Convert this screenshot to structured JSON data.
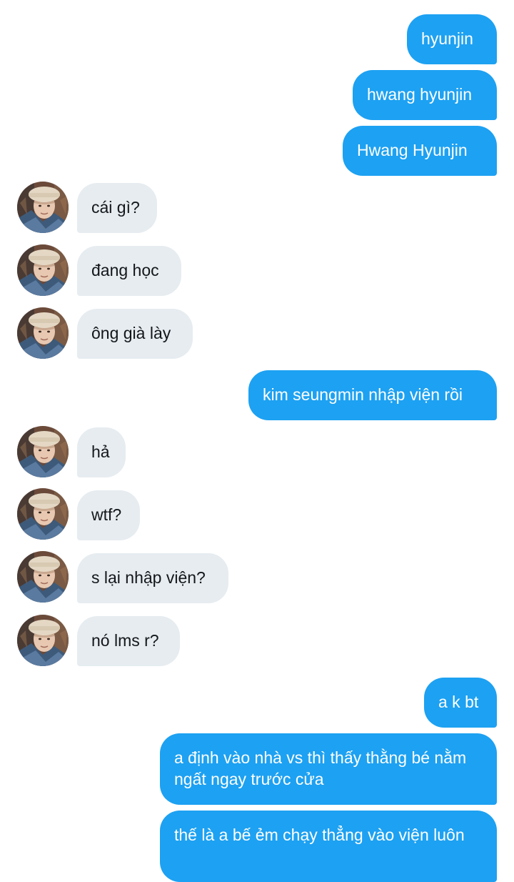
{
  "conversation": {
    "messages": [
      {
        "side": "sent",
        "text": "hyunjin"
      },
      {
        "side": "sent",
        "text": "hwang hyunjin"
      },
      {
        "side": "sent",
        "text": "Hwang Hyunjin"
      },
      {
        "side": "received",
        "text": "cái gì?"
      },
      {
        "side": "received",
        "text": "đang học"
      },
      {
        "side": "received",
        "text": "ông già lày"
      },
      {
        "side": "sent",
        "text": "kim seungmin nhập viện rồi"
      },
      {
        "side": "received",
        "text": "hả"
      },
      {
        "side": "received",
        "text": "wtf?"
      },
      {
        "side": "received",
        "text": "s lại nhập viện?"
      },
      {
        "side": "received",
        "text": "nó lms r?"
      },
      {
        "side": "sent",
        "text": "a k bt"
      },
      {
        "side": "sent",
        "text": "a định vào nhà vs thì thấy thằng bé nằm ngất ngay trước cửa"
      },
      {
        "side": "sent",
        "text": "thế là a bế ẻm chạy thẳng vào viện luôn"
      }
    ]
  },
  "colors": {
    "sent_bubble": "#1da1f2",
    "received_bubble": "#e6ecf0",
    "sent_text": "#ffffff",
    "received_text": "#14171a",
    "background": "#ffffff"
  },
  "icons": {
    "avatar": "user-avatar-photo"
  }
}
